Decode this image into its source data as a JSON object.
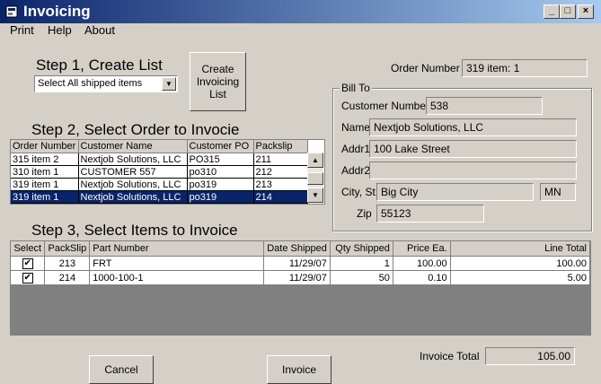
{
  "window": {
    "title": "Invoicing",
    "controls": {
      "minimize": "_",
      "maximize": "□",
      "close": "×"
    }
  },
  "menu": [
    "Print",
    "Help",
    "About"
  ],
  "step1": {
    "heading": "Step 1, Create List",
    "filter_selected": "Select All shipped items",
    "create_button": "Create\nInvoicing\nList"
  },
  "order_number": {
    "label": "Order Number",
    "value": "319 item: 1"
  },
  "bill_to": {
    "title": "Bill To",
    "customer_number_label": "Customer Number",
    "customer_number": "538",
    "name_label": "Name",
    "name": "Nextjob Solutions, LLC",
    "addr1_label": "Addr1",
    "addr1": "100 Lake Street",
    "addr2_label": "Addr2",
    "addr2": "",
    "city_label": "City, St.",
    "city": "Big City",
    "state": "MN",
    "zip_label": "Zip",
    "zip": "55123"
  },
  "step2": {
    "heading": "Step 2, Select Order to Invocie",
    "columns": [
      "Order Number",
      "Customer Name",
      "Customer PO",
      "Packslip"
    ],
    "rows": [
      [
        "315 item 2",
        "Nextjob Solutions, LLC",
        "PO315",
        "211"
      ],
      [
        "310 item 1",
        "CUSTOMER 557",
        "po310",
        "212"
      ],
      [
        "319 item 1",
        "Nextjob Solutions, LLC",
        "po319",
        "213"
      ],
      [
        "319 item 1",
        "Nextjob Solutions, LLC",
        "po319",
        "214"
      ]
    ],
    "selected_row": 3
  },
  "step3": {
    "heading": "Step 3, Select Items to Invoice",
    "columns": [
      "Select",
      "PackSlip",
      "Part Number",
      "Date Shipped",
      "Qty Shipped",
      "Price Ea.",
      "Line Total"
    ],
    "rows": [
      {
        "checked": "✔",
        "packslip": "213",
        "part": "FRT",
        "date": "11/29/07",
        "qty": "1",
        "price": "100.00",
        "total": "100.00"
      },
      {
        "checked": "✔",
        "packslip": "214",
        "part": "1000-100-1",
        "date": "11/29/07",
        "qty": "50",
        "price": "0.10",
        "total": "5.00"
      }
    ]
  },
  "invoice_total": {
    "label": "Invoice Total",
    "value": "105.00"
  },
  "buttons": {
    "cancel": "Cancel",
    "invoice": "Invoice"
  }
}
